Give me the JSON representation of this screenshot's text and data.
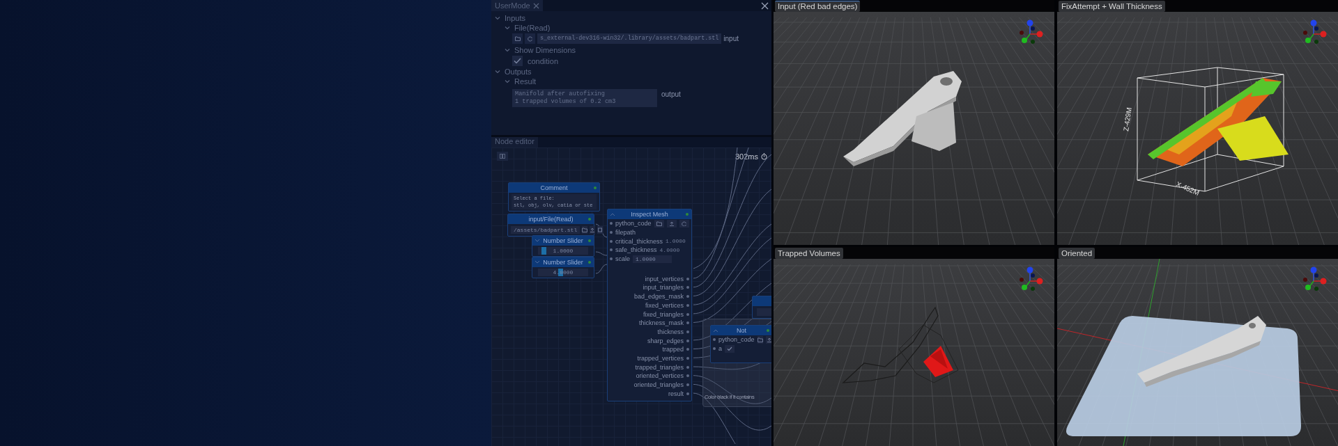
{
  "user_mode": {
    "title": "UserMode",
    "sections": [
      {
        "label": "Inputs",
        "expanded": true,
        "children": [
          {
            "label": "File(Read)",
            "expanded": true,
            "kind": "file",
            "value": "s_external-dev316-win32/.library/assets/badpart.stl",
            "port": "input"
          },
          {
            "label": "Show Dimensions",
            "expanded": true,
            "kind": "checkbox",
            "option": "condition",
            "checked": true
          }
        ]
      },
      {
        "label": "Outputs",
        "expanded": true,
        "children": [
          {
            "label": "Result",
            "expanded": true,
            "kind": "text",
            "lines": [
              "Manifold after autofixing",
              "1 trapped volumes of 0.2 cm3"
            ],
            "port": "output"
          }
        ]
      }
    ]
  },
  "node_editor": {
    "title": "Node editor",
    "timing": "302ms",
    "nodes": [
      {
        "kind": "comment",
        "title": "Comment",
        "lines": [
          "Select a file:",
          "stl, obj, olv, catia or ste"
        ]
      },
      {
        "kind": "file",
        "title": "input/File(Read)",
        "value": "/assets/badpart.stl"
      },
      {
        "kind": "slider",
        "title": "Number Slider",
        "value": "1.0000",
        "level": 0.12
      },
      {
        "kind": "slider",
        "title": "Number Slider",
        "value": "4.0000",
        "level": 0.45
      },
      {
        "kind": "node",
        "title": "Inspect Mesh",
        "inputs": [
          {
            "kind": "code",
            "name": "python_code"
          },
          {
            "kind": "port",
            "name": "filepath"
          },
          {
            "kind": "value",
            "name": "critical_thickness",
            "value": "1.0000"
          },
          {
            "kind": "value",
            "name": "safe_thickness",
            "value": "4.0000"
          },
          {
            "kind": "field",
            "name": "scale",
            "value": "1.0000"
          }
        ],
        "outputs": [
          "input_vertices",
          "input_triangles",
          "bad_edges_mask",
          "fixed_vertices",
          "fixed_triangles",
          "thickness_mask",
          "thickness",
          "sharp_edges",
          "trapped",
          "trapped_vertices",
          "trapped_triangles",
          "oriented_vertices",
          "oriented_triangles",
          "result"
        ]
      },
      {
        "kind": "stub"
      },
      {
        "kind": "group",
        "text": "Color black if it contains",
        "nodes": [
          {
            "kind": "node",
            "title": "Not",
            "inputs": [
              {
                "kind": "code",
                "name": "python_code"
              },
              {
                "kind": "checkbox",
                "name": "a",
                "checked": true
              }
            ]
          }
        ]
      }
    ]
  },
  "viewports": [
    {
      "title": "Input (Red bad edges)",
      "kind": "input",
      "selected": true
    },
    {
      "title": "FixAttempt + Wall Thickness",
      "kind": "fix",
      "selected": false,
      "axis_labels": [
        "Z-429M",
        "X-452M"
      ]
    },
    {
      "title": "Trapped Volumes",
      "kind": "trapped",
      "selected": false
    },
    {
      "title": "Oriented",
      "kind": "oriented",
      "selected": false
    }
  ]
}
